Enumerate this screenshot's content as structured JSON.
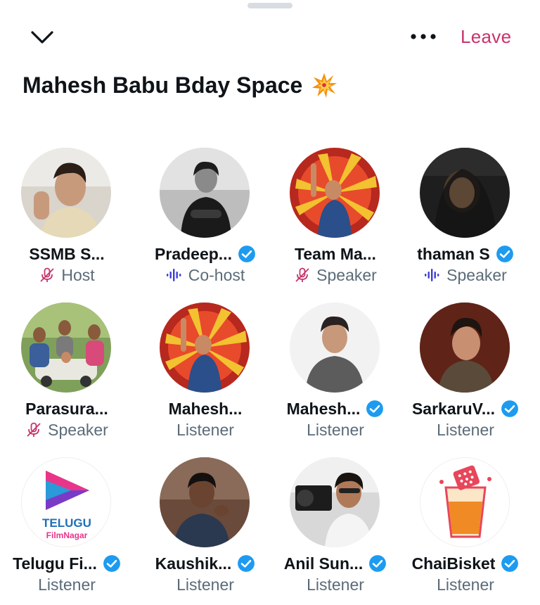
{
  "header": {
    "leave_label": "Leave",
    "collapse_icon": "chevron-down-icon",
    "more_icon": "more-horizontal-icon"
  },
  "space": {
    "title": "Mahesh Babu Bday Space",
    "title_emoji": "collision-emoji"
  },
  "colors": {
    "accent_pink": "#c8336b",
    "verified_blue": "#1d9bf0",
    "speaking_purple": "#3d3dd6",
    "secondary_text": "#5b6b79"
  },
  "participants": [
    {
      "name": "SSMB S...",
      "role": "Host",
      "verified": false,
      "role_icon": "mic-muted-icon"
    },
    {
      "name": "Pradeep...",
      "role": "Co-host",
      "verified": true,
      "role_icon": "speaking-waveform-icon"
    },
    {
      "name": "Team Ma...",
      "role": "Speaker",
      "verified": false,
      "role_icon": "mic-muted-icon"
    },
    {
      "name": "thaman S",
      "role": "Speaker",
      "verified": true,
      "role_icon": "speaking-waveform-icon"
    },
    {
      "name": "Parasura...",
      "role": "Speaker",
      "verified": false,
      "role_icon": "mic-muted-icon"
    },
    {
      "name": "Mahesh...",
      "role": "Listener",
      "verified": false,
      "role_icon": ""
    },
    {
      "name": "Mahesh...",
      "role": "Listener",
      "verified": true,
      "role_icon": ""
    },
    {
      "name": "SarkaruV...",
      "role": "Listener",
      "verified": true,
      "role_icon": ""
    },
    {
      "name": "Telugu Fi...",
      "role": "Listener",
      "verified": true,
      "role_icon": "",
      "avatar_text": [
        "TELUGU",
        "FilmNagar"
      ]
    },
    {
      "name": "Kaushik...",
      "role": "Listener",
      "verified": true,
      "role_icon": ""
    },
    {
      "name": "Anil Sun...",
      "role": "Listener",
      "verified": true,
      "role_icon": ""
    },
    {
      "name": "ChaiBisket",
      "role": "Listener",
      "verified": true,
      "role_icon": ""
    }
  ]
}
